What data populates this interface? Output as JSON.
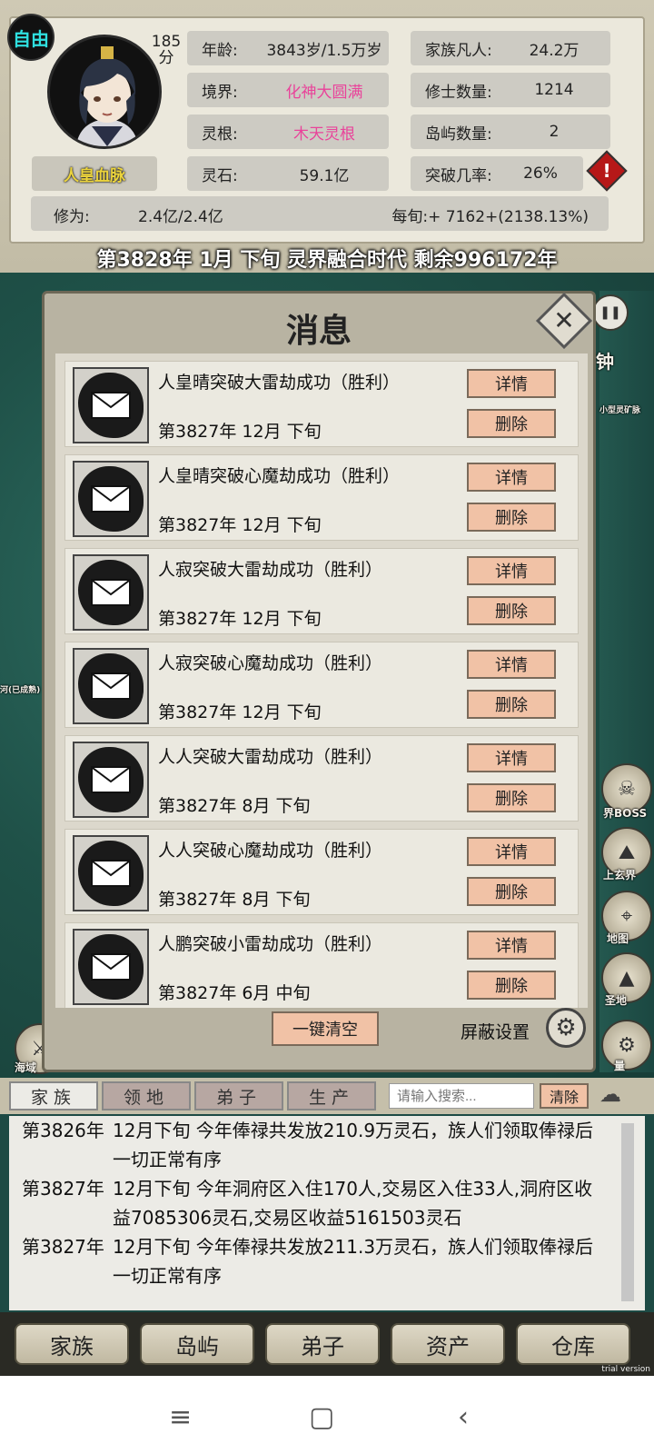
{
  "header": {
    "free_badge": "自由",
    "score_line1": "185",
    "score_line2": "分",
    "bloodline": "人皇血脉",
    "stats_left": [
      {
        "key": "年龄:",
        "value": "3843岁/1.5万岁"
      },
      {
        "key": "境界:",
        "value": "化神大圆满"
      },
      {
        "key": "灵根:",
        "value": "木天灵根"
      },
      {
        "key": "灵石:",
        "value": "59.1亿"
      }
    ],
    "stats_right": [
      {
        "key": "家族凡人:",
        "value": "24.2万"
      },
      {
        "key": "修士数量:",
        "value": "1214"
      },
      {
        "key": "岛屿数量:",
        "value": "2"
      },
      {
        "key": "突破几率:",
        "value": "26%"
      }
    ],
    "cultivation_key": "修为:",
    "cultivation_value": "2.4亿/2.4亿",
    "per_period": "每旬:+ 7162+(2138.13%)",
    "warning_glyph": "!",
    "date_line": "第3828年 1月 下旬  灵界融合时代 剩余996172年"
  },
  "map": {
    "clock_label": "钟",
    "mine_label": "小型灵矿脉",
    "built_label": "河(已成熟)",
    "boss_label": "界BOSS",
    "realm_label": "上玄界",
    "map_label": "地图",
    "land_label": "圣地",
    "sea_label": "海域",
    "settings_label": "量",
    "pause_glyph": "❚❚"
  },
  "dialog": {
    "title": "消息",
    "close_glyph": "✕",
    "detail_label": "详情",
    "delete_label": "删除",
    "messages": [
      {
        "title": "人皇晴突破大雷劫成功（胜利）",
        "date": "第3827年 12月 下旬"
      },
      {
        "title": "人皇晴突破心魔劫成功（胜利）",
        "date": "第3827年 12月 下旬"
      },
      {
        "title": "人寂突破大雷劫成功（胜利）",
        "date": "第3827年 12月 下旬"
      },
      {
        "title": "人寂突破心魔劫成功（胜利）",
        "date": "第3827年 12月 下旬"
      },
      {
        "title": "人人突破大雷劫成功（胜利）",
        "date": "第3827年 8月 下旬"
      },
      {
        "title": "人人突破心魔劫成功（胜利）",
        "date": "第3827年 8月 下旬"
      },
      {
        "title": "人鹏突破小雷劫成功（胜利）",
        "date": "第3827年 6月 中旬"
      }
    ],
    "clear_all": "一键清空",
    "filter_settings": "屏蔽设置",
    "gear_glyph": "⚙"
  },
  "log_panel": {
    "tabs": [
      "家族",
      "领地",
      "弟子",
      "生产"
    ],
    "search_placeholder": "请输入搜索...",
    "clear_label": "清除",
    "entries": [
      {
        "year": "第3826年",
        "text": "12月下旬 今年俸禄共发放210.9万灵石，族人们领取俸禄后一切正常有序"
      },
      {
        "year": "第3827年",
        "text": "12月下旬 今年洞府区入住170人,交易区入住33人,洞府区收益7085306灵石,交易区收益5161503灵石"
      },
      {
        "year": "第3827年",
        "text": "12月下旬 今年俸禄共发放211.3万灵石，族人们领取俸禄后一切正常有序"
      }
    ]
  },
  "bottom_nav": [
    "家族",
    "岛屿",
    "弟子",
    "资产",
    "仓库"
  ],
  "trial_text": "trial version",
  "system_nav": {
    "menu": "≡",
    "home": "▢",
    "back": "‹"
  }
}
